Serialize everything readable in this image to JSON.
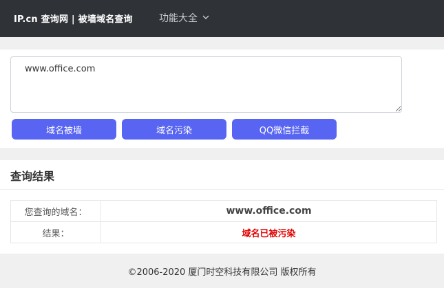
{
  "header": {
    "brand": "IP.cn 查询网 | 被墙域名查询",
    "menu_label": "功能大全"
  },
  "query": {
    "input_value": "www.office.com",
    "buttons": {
      "blocked": "域名被墙",
      "polluted": "域名污染",
      "qq_wechat": "QQ微信拦截"
    }
  },
  "result": {
    "title": "查询结果",
    "rows": [
      {
        "label": "您查询的域名：",
        "value": "www.office.com"
      },
      {
        "label": "结果：",
        "value": "域名已被污染"
      }
    ]
  },
  "footer": {
    "copyright": "©2006-2020 厦门时空科技有限公司 版权所有"
  },
  "colors": {
    "header_bg": "#2f3237",
    "button_bg": "#5865f2",
    "result_red": "#e00000"
  },
  "icons": {
    "menu": "chevron-down-icon"
  }
}
